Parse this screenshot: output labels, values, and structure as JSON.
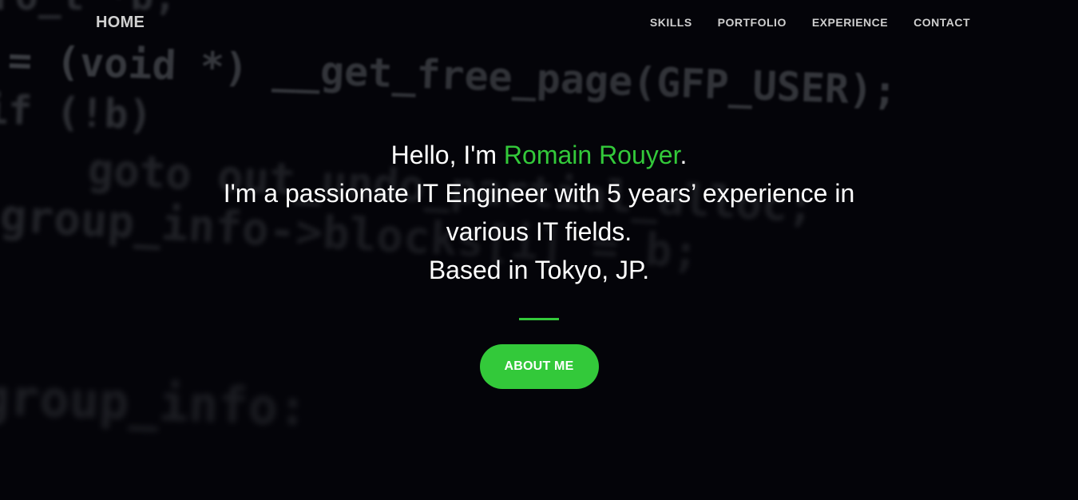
{
  "background_code": [
    "ro_t *b;",
    "= (void *) __get_free_page(GFP_USER);",
    "if (!b)",
    "goto out_undo_partial_alloc;",
    "group_info->blocks[i] = b;",
    "group_info:"
  ],
  "nav": {
    "brand": "HOME",
    "items": [
      {
        "label": "SKILLS"
      },
      {
        "label": "PORTFOLIO"
      },
      {
        "label": "EXPERIENCE"
      },
      {
        "label": "CONTACT"
      }
    ]
  },
  "hero": {
    "greeting_prefix": "Hello, I'm ",
    "name": "Romain Rouyer",
    "greeting_suffix": ".",
    "description": "I'm a passionate IT Engineer with 5 years’ experience in various IT fields.",
    "location": "Based in Tokyo, JP.",
    "cta_label": "ABOUT ME"
  },
  "colors": {
    "accent": "#33c93a",
    "background": "#040409",
    "text": "#ffffff",
    "nav_text": "#cfcfcf"
  }
}
